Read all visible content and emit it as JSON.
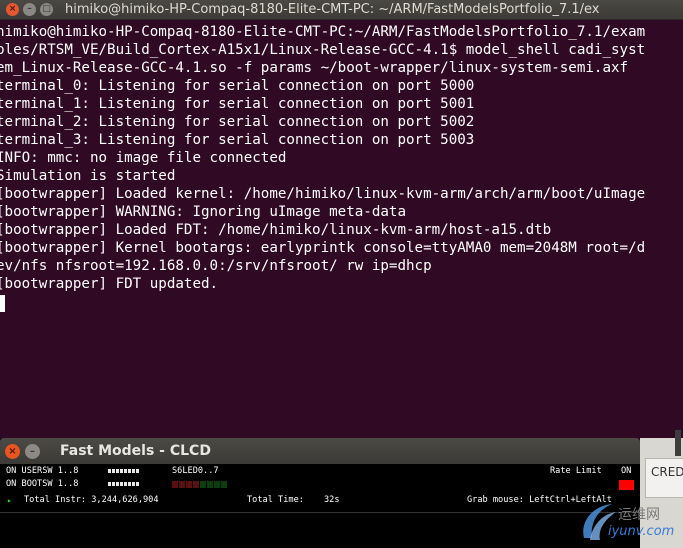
{
  "terminal": {
    "window_title": "himiko@himiko-HP-Compaq-8180-Elite-CMT-PC: ~/ARM/FastModelsPortfolio_7.1/ex",
    "lines": [
      "himiko@himiko-HP-Compaq-8180-Elite-CMT-PC:~/ARM/FastModelsPortfolio_7.1/exam",
      "ples/RTSM_VE/Build_Cortex-A15x1/Linux-Release-GCC-4.1$ model_shell cadi_syst",
      "em_Linux-Release-GCC-4.1.so -f params ~/boot-wrapper/linux-system-semi.axf",
      "terminal_0: Listening for serial connection on port 5000",
      "terminal_1: Listening for serial connection on port 5001",
      "terminal_2: Listening for serial connection on port 5002",
      "terminal_3: Listening for serial connection on port 5003",
      "INFO: mmc: no image file connected",
      "Simulation is started",
      "[bootwrapper] Loaded kernel: /home/himiko/linux-kvm-arm/arch/arm/boot/uImage",
      "[bootwrapper] WARNING: Ignoring uImage meta-data",
      "[bootwrapper] Loaded FDT: /home/himiko/linux-kvm-arm/host-a15.dtb",
      "[bootwrapper] Kernel bootargs: earlyprintk console=ttyAMA0 mem=2048M root=/d",
      "ev/nfs nfsroot=192.168.0.0:/srv/nfsroot/ rw ip=dhcp",
      "[bootwrapper] FDT updated."
    ]
  },
  "clcd": {
    "window_title": "Fast Models - CLCD",
    "usersw_label": "ON USERSW 1..8",
    "bootsw_label": "ON BOOTSW 1..8",
    "s6led_label": "S6LED0..7",
    "rate_limit_label": "Rate Limit",
    "rate_limit_value": "ON",
    "total_instr": "Total Instr: 3,244,626,904",
    "total_time_label": "Total Time:",
    "total_time_value": "32s",
    "grab_mouse": "Grab mouse: LeftCtrl+LeftAlt",
    "rate_indicator_color": "#ff0000",
    "run_state_color": "#33dd33"
  },
  "desktop": {
    "credit_text": "CRED"
  },
  "watermark": {
    "title": "运维网",
    "url": "iyunv.com"
  },
  "colors": {
    "terminal_bg": "#300a24",
    "titlebar": "#3c3b37",
    "close_button": "#e95420"
  }
}
